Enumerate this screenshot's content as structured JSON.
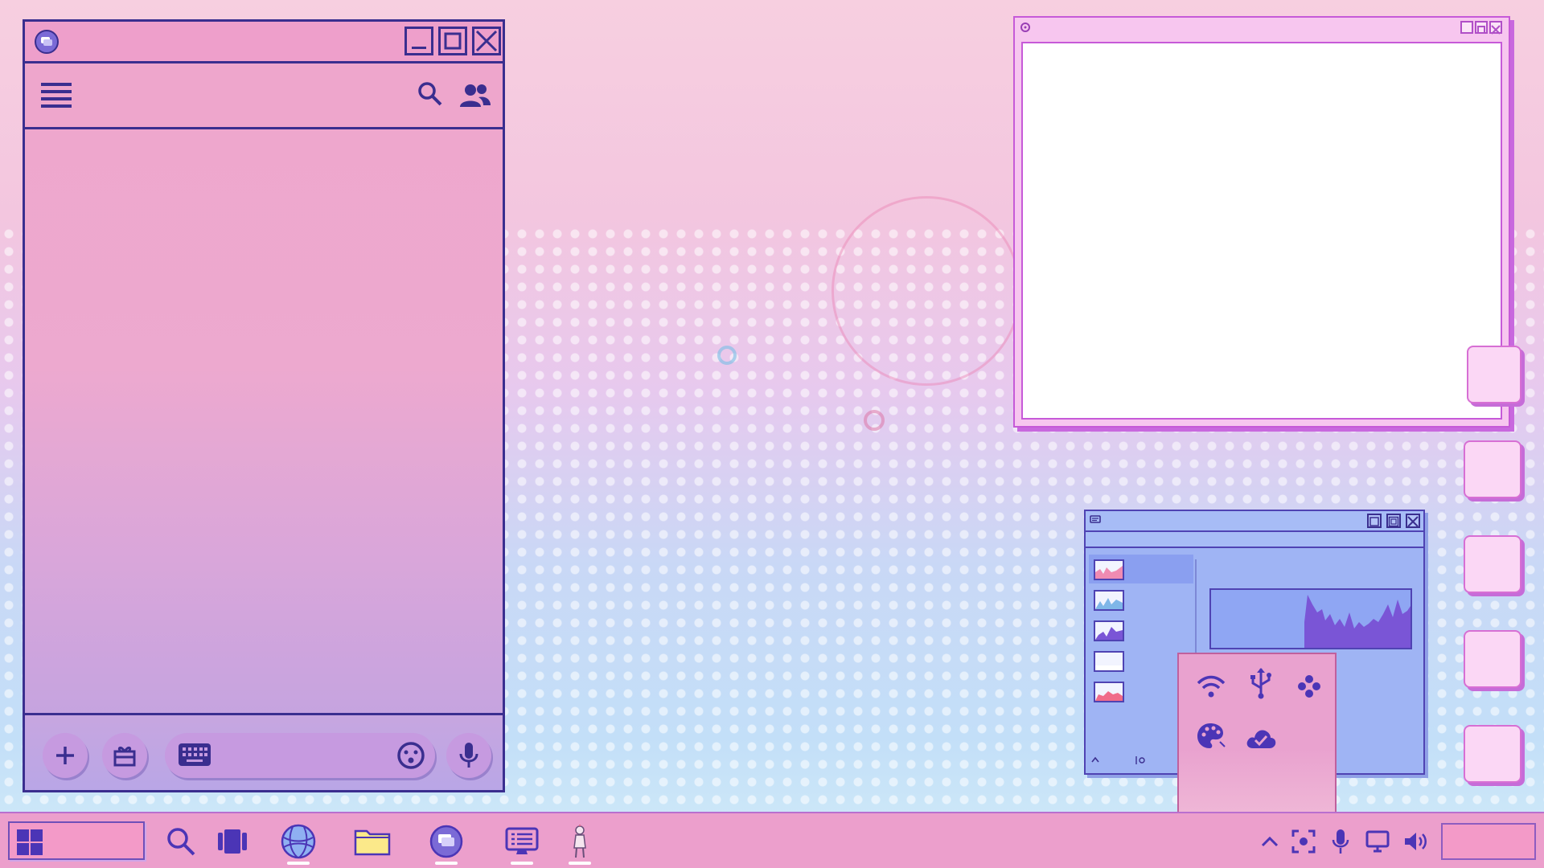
{
  "chat_window": {
    "title": "",
    "message_placeholder": "",
    "icons": {
      "app": "chat-bubble-icon",
      "menu": "hamburger-menu-icon",
      "search": "search-icon",
      "people": "people-icon",
      "add": "plus-icon",
      "gift": "gift-icon",
      "keyboard": "keyboard-icon",
      "emoji": "emoji-icon",
      "mic": "microphone-icon"
    }
  },
  "preview_window": {
    "title": ""
  },
  "monitor_window": {
    "title": "",
    "items": [
      {
        "name": "graph-1",
        "fill": "#f08bb2"
      },
      {
        "name": "graph-2",
        "fill": "#7fb6e8"
      },
      {
        "name": "graph-3",
        "fill": "#7a55d6"
      },
      {
        "name": "graph-4",
        "fill": "#ffffff"
      },
      {
        "name": "graph-5",
        "fill": "#f06b8a"
      }
    ],
    "selected_index": 0
  },
  "tray_popup": {
    "icons": [
      "wifi-icon",
      "usb-icon",
      "gamepad-icon",
      "palette-icon",
      "cloud-check-icon"
    ]
  },
  "taskbar": {
    "pinned": [
      "search-icon",
      "task-view-icon",
      "browser-icon",
      "file-explorer-icon",
      "chat-app-icon",
      "terminal-icon",
      "character-app-icon"
    ],
    "tray": [
      "chevron-up-icon",
      "screenshot-icon",
      "microphone-icon",
      "display-icon",
      "volume-icon"
    ],
    "clock": ""
  },
  "colors": {
    "outline": "#3a2e8f",
    "pink": "#eea6cc",
    "violet": "#7b6ad6",
    "blue_window": "#9fb4f4"
  }
}
